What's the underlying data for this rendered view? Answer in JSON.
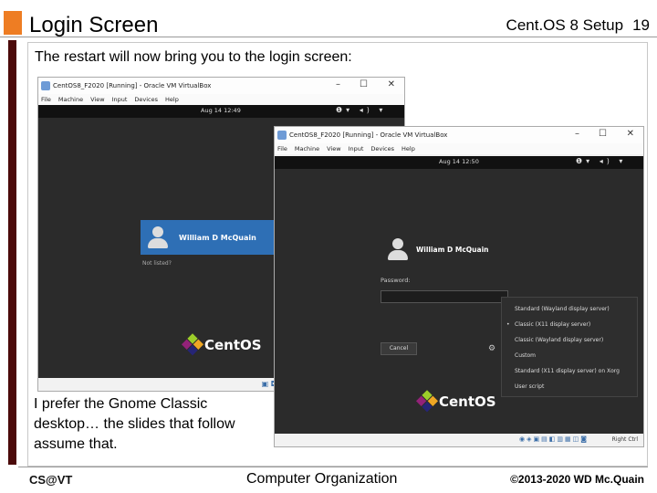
{
  "slide": {
    "title": "Login Screen",
    "deck": "Cent.OS 8 Setup",
    "number": "19",
    "intro": "The restart will now bring you to the login screen:",
    "caption": "I prefer the Gnome Classic desktop… the slides that follow assume that."
  },
  "footer": {
    "left": "CS@VT",
    "center": "Computer Organization",
    "right": "©2013-2020 WD Mc.Quain"
  },
  "vm_back": {
    "title": "CentOS8_F2020 [Running] - Oracle VM VirtualBox",
    "menu": [
      "File",
      "Machine",
      "View",
      "Input",
      "Devices",
      "Help"
    ],
    "clock": "Aug 14 12:49",
    "user_name": "William D McQuain",
    "not_listed": "Not listed?",
    "logo_text": "CentOS"
  },
  "vm_front": {
    "title": "CentOS8_F2020 [Running] - Oracle VM VirtualBox",
    "menu": [
      "File",
      "Machine",
      "View",
      "Input",
      "Devices",
      "Help"
    ],
    "clock": "Aug 14 12:50",
    "user_name": "William D McQuain",
    "password_label": "Password:",
    "cancel_label": "Cancel",
    "logo_text": "CentOS",
    "host_key": "Right Ctrl",
    "sessions": [
      "Standard (Wayland display server)",
      "Classic (X11 display server)",
      "Classic (Wayland display server)",
      "Custom",
      "Standard (X11 display server) on Xorg",
      "User script"
    ],
    "selected_session_bullet": "•"
  },
  "colors": {
    "accent_orange": "#ee7d23",
    "side_bar": "#4b0a0a",
    "user_tile": "#2e6fb5"
  }
}
